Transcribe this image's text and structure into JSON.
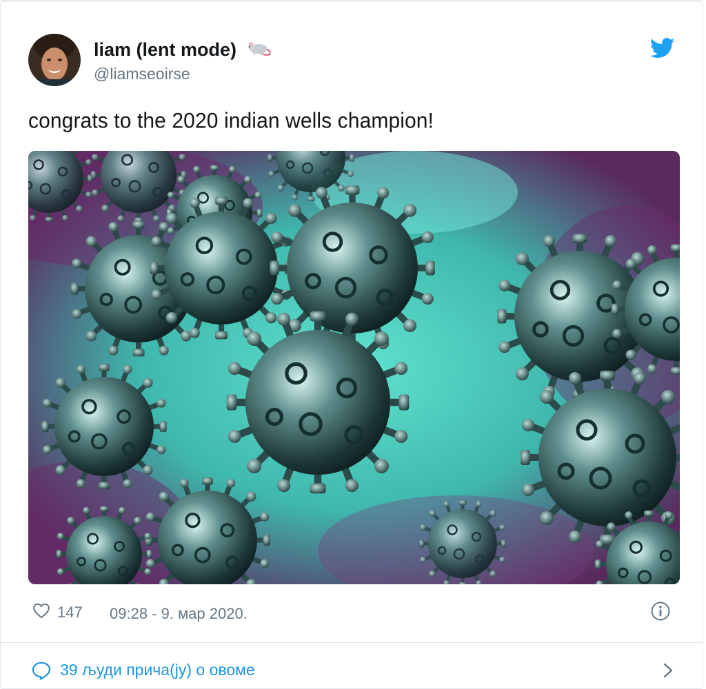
{
  "author": {
    "display_name": "liam (lent mode)",
    "handle": "@liamseoirse",
    "name_emoji": "rat-emoji"
  },
  "tweet": {
    "text": "congrats to the 2020 indian wells champion!",
    "media_description": "coronavirus-illustration"
  },
  "footer": {
    "like_count": "147",
    "timestamp": "09:28 - 9. мар 2020."
  },
  "conversation": {
    "label": "39 људи прича(ју) о овоме"
  },
  "icons": {
    "twitter_logo": "twitter-bird-icon",
    "like": "heart-icon",
    "info": "info-icon",
    "conversation": "speech-bubble-icon",
    "chevron": "chevron-right-icon"
  },
  "colors": {
    "twitter_blue": "#1da1f2",
    "link_blue": "#1b95e0",
    "secondary_text": "#657786",
    "primary_text": "#14171a",
    "border": "#e1e8ed"
  }
}
